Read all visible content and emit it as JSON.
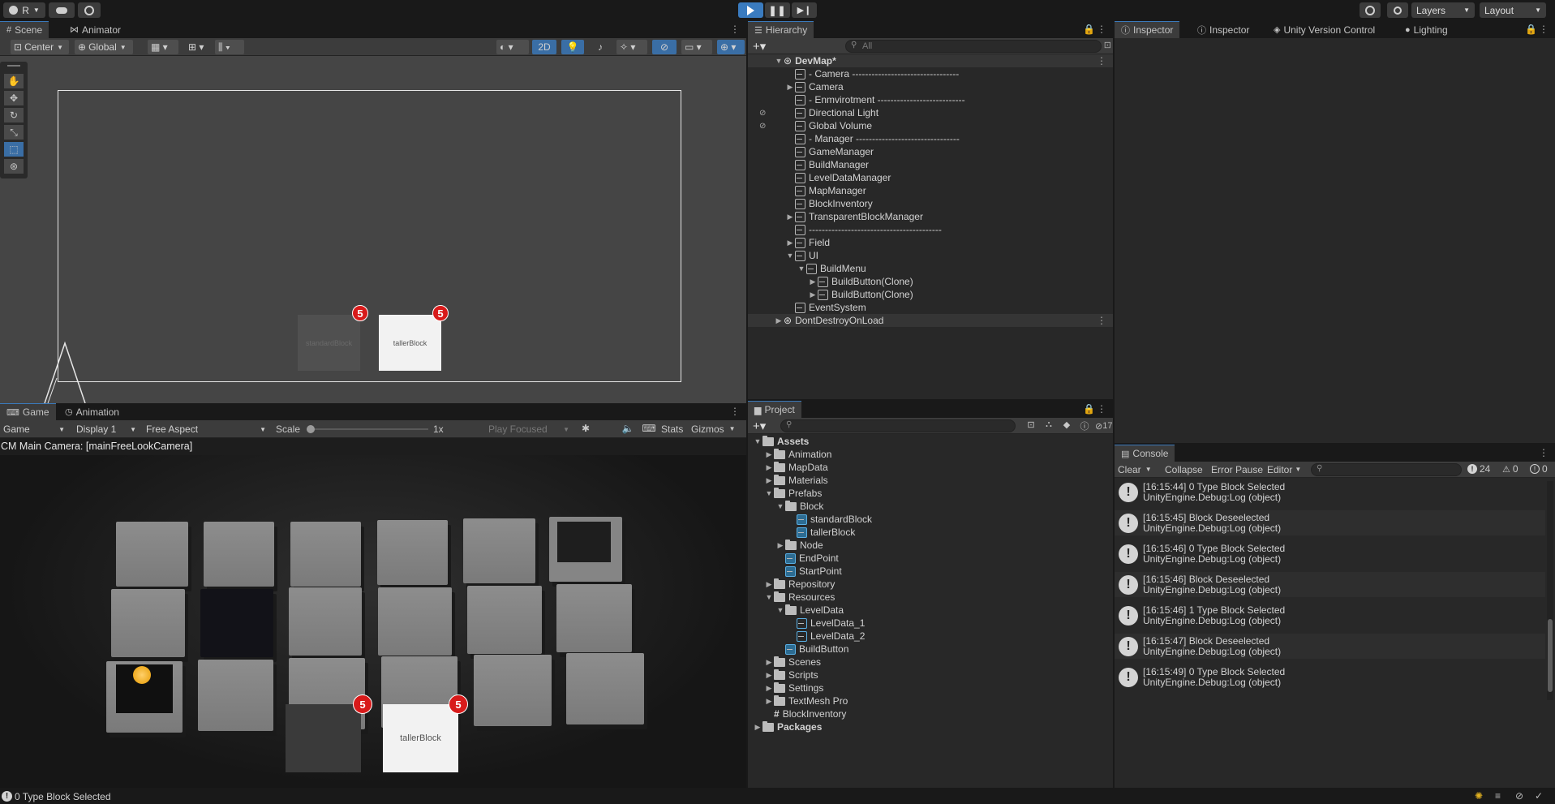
{
  "toolbar": {
    "account": "R",
    "layers": "Layers",
    "layout": "Layout"
  },
  "scene": {
    "tabs": [
      "Scene",
      "Animator"
    ],
    "pivot": "Center",
    "space": "Global",
    "mode2d": "2D",
    "ui_blocks": [
      {
        "label": "standardBlock",
        "count": "5"
      },
      {
        "label": "tallerBlock",
        "count": "5"
      }
    ]
  },
  "game": {
    "tabs": [
      "Game",
      "Animation"
    ],
    "view": "Game",
    "display": "Display 1",
    "aspect": "Free Aspect",
    "scale_label": "Scale",
    "scale_value": "1x",
    "play_focused": "Play Focused",
    "stats": "Stats",
    "gizmos": "Gizmos",
    "camera_label": "CM Main Camera: [mainFreeLookCamera]",
    "ui_blocks": [
      {
        "label": "",
        "count": "5"
      },
      {
        "label": "tallerBlock",
        "count": "5"
      }
    ]
  },
  "hierarchy": {
    "title": "Hierarchy",
    "search_placeholder": "All",
    "items": [
      {
        "label": "DevMap*",
        "depth": 0,
        "arrow": "down",
        "type": "scene",
        "bold": true
      },
      {
        "label": "- Camera ---------------------------------",
        "depth": 1,
        "arrow": "",
        "type": "obj"
      },
      {
        "label": "Camera",
        "depth": 1,
        "arrow": "right",
        "type": "obj"
      },
      {
        "label": "- Enmvirotment ---------------------------",
        "depth": 1,
        "arrow": "",
        "type": "obj"
      },
      {
        "label": "Directional Light",
        "depth": 1,
        "arrow": "",
        "type": "obj",
        "hidden": true
      },
      {
        "label": "Global Volume",
        "depth": 1,
        "arrow": "",
        "type": "obj",
        "hidden": true
      },
      {
        "label": "- Manager --------------------------------",
        "depth": 1,
        "arrow": "",
        "type": "obj"
      },
      {
        "label": "GameManager",
        "depth": 1,
        "arrow": "",
        "type": "obj"
      },
      {
        "label": "BuildManager",
        "depth": 1,
        "arrow": "",
        "type": "obj"
      },
      {
        "label": "LevelDataManager",
        "depth": 1,
        "arrow": "",
        "type": "obj"
      },
      {
        "label": "MapManager",
        "depth": 1,
        "arrow": "",
        "type": "obj"
      },
      {
        "label": "BlockInventory",
        "depth": 1,
        "arrow": "",
        "type": "obj"
      },
      {
        "label": "TransparentBlockManager",
        "depth": 1,
        "arrow": "right",
        "type": "obj"
      },
      {
        "label": "-----------------------------------------",
        "depth": 1,
        "arrow": "",
        "type": "obj"
      },
      {
        "label": "Field",
        "depth": 1,
        "arrow": "right",
        "type": "obj"
      },
      {
        "label": "UI",
        "depth": 1,
        "arrow": "down",
        "type": "obj"
      },
      {
        "label": "BuildMenu",
        "depth": 2,
        "arrow": "down",
        "type": "obj"
      },
      {
        "label": "BuildButton(Clone)",
        "depth": 3,
        "arrow": "right",
        "type": "obj"
      },
      {
        "label": "BuildButton(Clone)",
        "depth": 3,
        "arrow": "right",
        "type": "obj"
      },
      {
        "label": "EventSystem",
        "depth": 1,
        "arrow": "",
        "type": "obj"
      },
      {
        "label": "DontDestroyOnLoad",
        "depth": 0,
        "arrow": "right",
        "type": "scene"
      }
    ]
  },
  "inspector": {
    "tabs": [
      "Inspector",
      "Inspector",
      "Unity Version Control",
      "Lighting"
    ]
  },
  "project": {
    "title": "Project",
    "hidden_count": "17",
    "items": [
      {
        "label": "Assets",
        "depth": 0,
        "arrow": "down",
        "type": "folder",
        "bold": true
      },
      {
        "label": "Animation",
        "depth": 1,
        "arrow": "right",
        "type": "folder"
      },
      {
        "label": "MapData",
        "depth": 1,
        "arrow": "right",
        "type": "folder"
      },
      {
        "label": "Materials",
        "depth": 1,
        "arrow": "right",
        "type": "folder"
      },
      {
        "label": "Prefabs",
        "depth": 1,
        "arrow": "down",
        "type": "folder"
      },
      {
        "label": "Block",
        "depth": 2,
        "arrow": "down",
        "type": "folder"
      },
      {
        "label": "standardBlock",
        "depth": 3,
        "arrow": "",
        "type": "prefab"
      },
      {
        "label": "tallerBlock",
        "depth": 3,
        "arrow": "",
        "type": "prefab"
      },
      {
        "label": "Node",
        "depth": 2,
        "arrow": "right",
        "type": "folder"
      },
      {
        "label": "EndPoint",
        "depth": 2,
        "arrow": "",
        "type": "prefab"
      },
      {
        "label": "StartPoint",
        "depth": 2,
        "arrow": "",
        "type": "prefab"
      },
      {
        "label": "Repository",
        "depth": 1,
        "arrow": "right",
        "type": "folder"
      },
      {
        "label": "Resources",
        "depth": 1,
        "arrow": "down",
        "type": "folder"
      },
      {
        "label": "LevelData",
        "depth": 2,
        "arrow": "down",
        "type": "folder"
      },
      {
        "label": "LevelData_1",
        "depth": 3,
        "arrow": "",
        "type": "asset"
      },
      {
        "label": "LevelData_2",
        "depth": 3,
        "arrow": "",
        "type": "asset"
      },
      {
        "label": "BuildButton",
        "depth": 2,
        "arrow": "",
        "type": "prefab"
      },
      {
        "label": "Scenes",
        "depth": 1,
        "arrow": "right",
        "type": "folder"
      },
      {
        "label": "Scripts",
        "depth": 1,
        "arrow": "right",
        "type": "folder"
      },
      {
        "label": "Settings",
        "depth": 1,
        "arrow": "right",
        "type": "folder"
      },
      {
        "label": "TextMesh Pro",
        "depth": 1,
        "arrow": "right",
        "type": "folder"
      },
      {
        "label": "BlockInventory",
        "depth": 1,
        "arrow": "",
        "type": "script"
      },
      {
        "label": "Packages",
        "depth": 0,
        "arrow": "right",
        "type": "folder",
        "bold": true
      }
    ]
  },
  "console": {
    "title": "Console",
    "clear": "Clear",
    "collapse": "Collapse",
    "error_pause": "Error Pause",
    "editor": "Editor",
    "log_count": "24",
    "warn_count": "0",
    "error_count": "0",
    "entries": [
      {
        "line1": "[16:15:44] 0 Type Block Selected",
        "line2": "UnityEngine.Debug:Log (object)"
      },
      {
        "line1": "[16:15:45] Block Deseelected",
        "line2": "UnityEngine.Debug:Log (object)"
      },
      {
        "line1": "[16:15:46] 0 Type Block Selected",
        "line2": "UnityEngine.Debug:Log (object)"
      },
      {
        "line1": "[16:15:46] Block Deseelected",
        "line2": "UnityEngine.Debug:Log (object)"
      },
      {
        "line1": "[16:15:46] 1 Type Block Selected",
        "line2": "UnityEngine.Debug:Log (object)"
      },
      {
        "line1": "[16:15:47] Block Deseelected",
        "line2": "UnityEngine.Debug:Log (object)"
      },
      {
        "line1": "[16:15:49] 0 Type Block Selected",
        "line2": "UnityEngine.Debug:Log (object)"
      }
    ]
  },
  "statusbar": {
    "message": "0 Type Block Selected"
  }
}
